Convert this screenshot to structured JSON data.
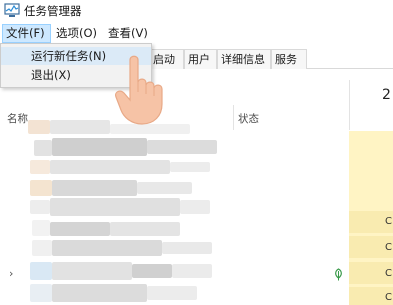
{
  "window": {
    "title": "任务管理器",
    "icon": "task-manager-icon"
  },
  "menubar": {
    "file": "文件(F)",
    "options": "选项(O)",
    "view": "查看(V)"
  },
  "file_menu": {
    "items": [
      {
        "label": "运行新任务(N)",
        "highlighted": true
      },
      {
        "label": "退出(X)",
        "highlighted": false
      }
    ]
  },
  "tabs": [
    {
      "label": "启动"
    },
    {
      "label": "用户"
    },
    {
      "label": "详细信息"
    },
    {
      "label": "服务"
    }
  ],
  "table": {
    "columns": {
      "name": "名称",
      "status": "状态",
      "cpu_percent_partial": "2"
    },
    "cpu_values_partial": [
      "C",
      "C",
      "C",
      "C"
    ]
  },
  "colors": {
    "menu_active_bg": "#cde8ff",
    "cpu_column_bg": "#fff4c4",
    "dropdown_bg": "#f2f2f2",
    "leaf_green": "#3a9a4a"
  },
  "icons": {
    "cursor": "hand-pointer-icon",
    "expand": "chevron-right-icon",
    "efficiency": "leaf-icon"
  }
}
